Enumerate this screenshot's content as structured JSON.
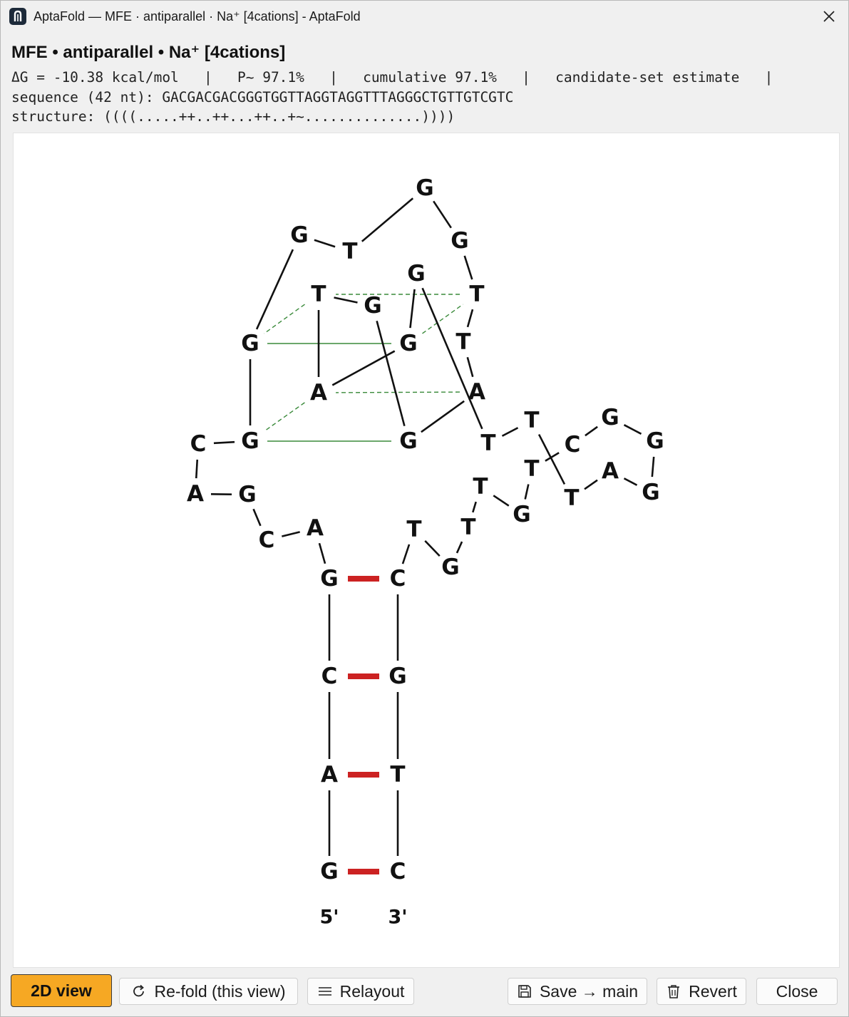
{
  "window": {
    "title": "AptaFold — MFE · antiparallel · Na⁺ [4cations] - AptaFold",
    "close_label": "×"
  },
  "header": {
    "heading": "MFE • antiparallel • Na⁺ [4cations]",
    "stats_line": "ΔG = -10.38 kcal/mol   |   P~ 97.1%   |   cumulative 97.1%   |   candidate-set estimate   |",
    "sequence_line": "sequence (42 nt): GACGACGACGGGTGGTTAGGTAGGTTTAGGGCTGTTGTCGTC",
    "structure_line": "structure: ((((.....++..++...++..+~..............))))"
  },
  "diagram": {
    "sequence": "GACGACGACGGGTGGTTAGGTAGGTTTAGGGCTGTTGTCGTC",
    "five_prime_label": "5'",
    "three_prime_label": "3'",
    "colors": {
      "backbone": "#111111",
      "watson_crick_pair": "#cc2222",
      "g_quartet_bond": "#3a8a3a"
    }
  },
  "buttons": {
    "view_2d": "2D view",
    "refold": "Re-fold (this view)",
    "relayout": "Relayout",
    "save_main": "Save → main",
    "revert": "Revert",
    "close": "Close"
  }
}
